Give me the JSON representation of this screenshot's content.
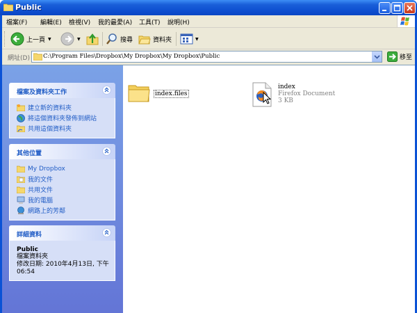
{
  "window": {
    "title": "Public"
  },
  "menu": [
    "檔案(F)",
    "編輯(E)",
    "檢視(V)",
    "我的最愛(A)",
    "工具(T)",
    "說明(H)"
  ],
  "toolbar": {
    "back_label": "上一頁",
    "search_label": "搜尋",
    "folders_label": "資料夾"
  },
  "address": {
    "label": "網址(D)",
    "path": "C:\\Program Files\\Dropbox\\My Dropbox\\My Dropbox\\Public",
    "go_label": "移至"
  },
  "tasks_panel": {
    "title": "檔案及資料夾工作",
    "items": [
      "建立新的資料夾",
      "將這個資料夾發佈到網站",
      "共用這個資料夾"
    ]
  },
  "places_panel": {
    "title": "其他位置",
    "items": [
      "My Dropbox",
      "我的文件",
      "共用文件",
      "我的電腦",
      "網路上的芳鄰"
    ]
  },
  "details_panel": {
    "title": "詳細資料",
    "name": "Public",
    "type": "檔案資料夾",
    "modified_line1": "修改日期: 2010年4月13日, 下午",
    "modified_line2": "06:54"
  },
  "files": [
    {
      "name": "index.files"
    },
    {
      "name": "index",
      "type": "Firefox Document",
      "size": "3 KB"
    }
  ],
  "colors": {
    "title_blue": "#0a52d6",
    "taskpane_link": "#215dc6",
    "taskpane_bg": "#6375d6"
  }
}
